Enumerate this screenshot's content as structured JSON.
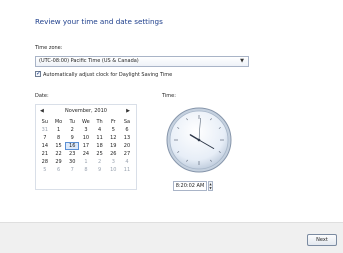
{
  "title": "Review your time and date settings",
  "timezone": {
    "label": "Time zone:",
    "value": "(UTC-08:00) Pacific Time (US & Canada)"
  },
  "dst": {
    "label": "Automatically adjust clock for Daylight Saving Time",
    "checked": true
  },
  "date": {
    "label": "Date:",
    "month_label": "November, 2010",
    "weekdays": [
      "Su",
      "Mo",
      "Tu",
      "We",
      "Th",
      "Fr",
      "Sa"
    ],
    "rows": [
      [
        "31",
        "1",
        "2",
        "3",
        "4",
        "5",
        "6"
      ],
      [
        "7",
        "8",
        "9",
        "10",
        "11",
        "12",
        "13"
      ],
      [
        "14",
        "15",
        "16",
        "17",
        "18",
        "19",
        "20"
      ],
      [
        "21",
        "22",
        "23",
        "24",
        "25",
        "26",
        "27"
      ],
      [
        "28",
        "29",
        "30",
        "1",
        "2",
        "3",
        "4"
      ],
      [
        "5",
        "6",
        "7",
        "8",
        "9",
        "10",
        "11"
      ]
    ],
    "selected_day": "16"
  },
  "time": {
    "label": "Time:",
    "value": "8:20:02 AM"
  },
  "footer": {
    "next_label": "Next"
  }
}
